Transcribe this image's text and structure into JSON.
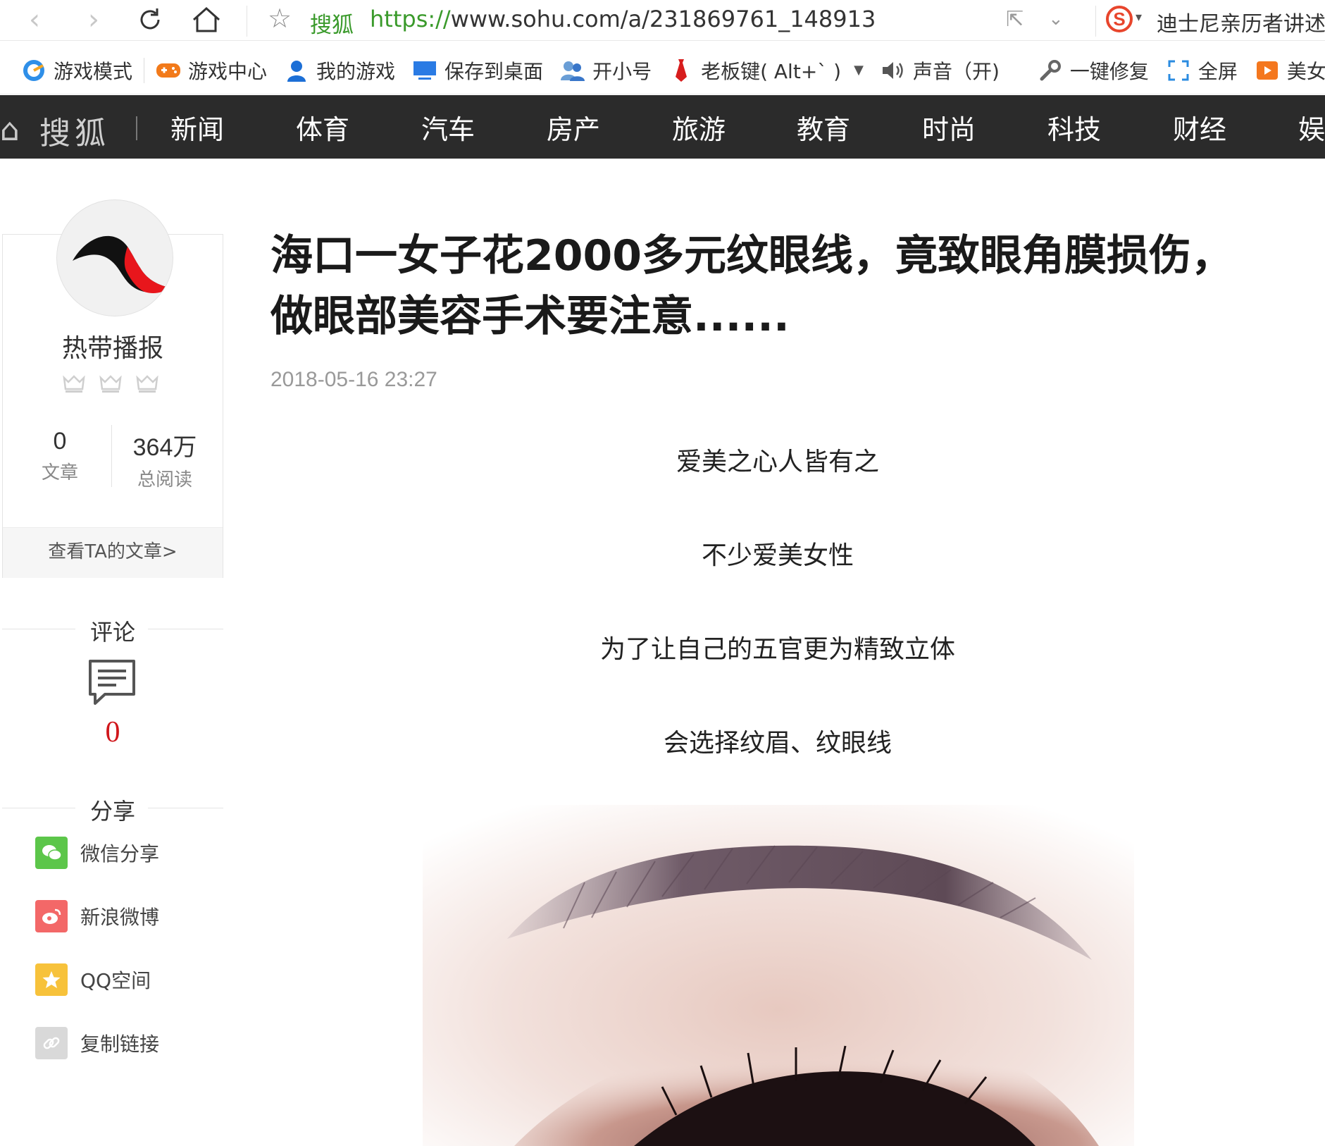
{
  "browser": {
    "site_name": "搜狐",
    "url_protocol": "https://",
    "url_rest": "www.sohu.com/a/231869761_148913",
    "search_hint": "迪士尼亲历者讲述"
  },
  "toolbar": {
    "items": [
      {
        "label": "游戏模式"
      },
      {
        "label": "游戏中心"
      },
      {
        "label": "我的游戏"
      },
      {
        "label": "保存到桌面"
      },
      {
        "label": "开小号"
      },
      {
        "label": "老板键( Alt+` )"
      },
      {
        "label": "声音（开)"
      },
      {
        "label": "一键修复"
      },
      {
        "label": "全屏"
      },
      {
        "label": "美女"
      }
    ]
  },
  "nav": {
    "logo": "搜狐",
    "links": [
      "新闻",
      "体育",
      "汽车",
      "房产",
      "旅游",
      "教育",
      "时尚",
      "科技",
      "财经",
      "娱"
    ]
  },
  "author": {
    "name": "热带播报",
    "articles_count": "0",
    "articles_label": "文章",
    "reads_count": "364万",
    "reads_label": "总阅读",
    "view_link": "查看TA的文章>"
  },
  "comments": {
    "heading": "评论",
    "count": "0"
  },
  "share": {
    "heading": "分享",
    "items": [
      {
        "label": "微信分享",
        "color": "#5cc64a"
      },
      {
        "label": "新浪微博",
        "color": "#f36868"
      },
      {
        "label": "QQ空间",
        "color": "#f7c23b"
      },
      {
        "label": "复制链接",
        "color": "#d9d9d9"
      }
    ]
  },
  "article": {
    "title_line1": "海口一女子花2000多元纹眼线，竟致眼角膜损伤，",
    "title_line2": "做眼部美容手术要注意......",
    "date": "2018-05-16 23:27",
    "paragraphs": [
      "爱美之心人皆有之",
      "不少爱美女性",
      "为了让自己的五官更为精致立体",
      "会选择纹眉、纹眼线"
    ]
  },
  "colors": {
    "nav_bg": "#2b2b2b",
    "accent_red": "#d0161b",
    "url_green": "#3a9a2b"
  }
}
